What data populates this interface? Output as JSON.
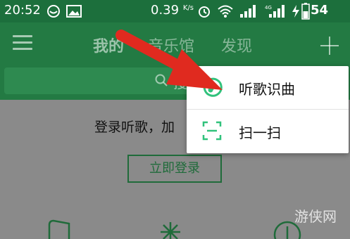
{
  "status_bar": {
    "time": "20:52",
    "speed": "0.39",
    "speed_unit": "K/s",
    "network": "4G",
    "battery": "54",
    "icons": [
      "circle-app-icon",
      "image-icon",
      "alarm-icon",
      "wifi-icon",
      "signal-icon",
      "signal-4g-icon",
      "charging-icon",
      "battery-icon"
    ]
  },
  "header": {
    "tabs": [
      {
        "label": "我的"
      },
      {
        "label": "音乐馆"
      },
      {
        "label": "发现"
      }
    ],
    "menu_icon": "hamburger-menu-icon",
    "add_icon": "plus-icon"
  },
  "search": {
    "placeholder": "搜"
  },
  "content": {
    "login_prompt": "登录听歌，加",
    "login_button": "立即登录"
  },
  "popup": {
    "items": [
      {
        "label": "听歌识曲",
        "icon": "music-recognition-icon"
      },
      {
        "label": "扫一扫",
        "icon": "scan-icon"
      }
    ]
  },
  "watermark": "游侠网",
  "colors": {
    "brand_green": "#237a43",
    "status_green": "#1c6f3c",
    "accent_green": "#31c27c",
    "arrow_red": "#e02a1f",
    "overlay_gray": "#8a8a8a"
  }
}
